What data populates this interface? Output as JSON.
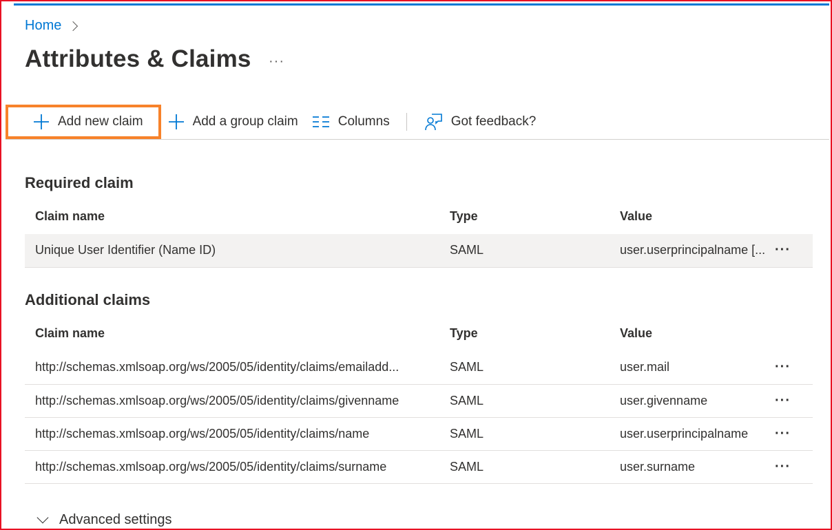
{
  "breadcrumb": {
    "home": "Home"
  },
  "page": {
    "title": "Attributes & Claims",
    "more": "···"
  },
  "toolbar": {
    "add_new_claim": "Add new claim",
    "add_group_claim": "Add a group claim",
    "columns": "Columns",
    "feedback": "Got feedback?"
  },
  "required": {
    "title": "Required claim",
    "headers": {
      "name": "Claim name",
      "type": "Type",
      "value": "Value"
    },
    "rows": [
      {
        "name": "Unique User Identifier (Name ID)",
        "type": "SAML",
        "value": "user.userprincipalname [...",
        "more": "···"
      }
    ]
  },
  "additional": {
    "title": "Additional claims",
    "headers": {
      "name": "Claim name",
      "type": "Type",
      "value": "Value"
    },
    "rows": [
      {
        "name": "http://schemas.xmlsoap.org/ws/2005/05/identity/claims/emailadd...",
        "type": "SAML",
        "value": "user.mail",
        "more": "···"
      },
      {
        "name": "http://schemas.xmlsoap.org/ws/2005/05/identity/claims/givenname",
        "type": "SAML",
        "value": "user.givenname",
        "more": "···"
      },
      {
        "name": "http://schemas.xmlsoap.org/ws/2005/05/identity/claims/name",
        "type": "SAML",
        "value": "user.userprincipalname",
        "more": "···"
      },
      {
        "name": "http://schemas.xmlsoap.org/ws/2005/05/identity/claims/surname",
        "type": "SAML",
        "value": "user.surname",
        "more": "···"
      }
    ]
  },
  "advanced": {
    "label": "Advanced settings"
  },
  "colors": {
    "accent": "#0078d4",
    "highlight": "#f7822a",
    "border": "#e81123"
  }
}
